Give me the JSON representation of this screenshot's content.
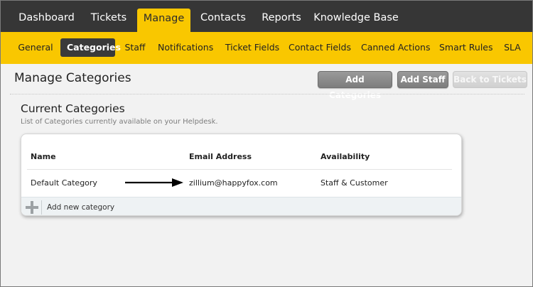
{
  "topnav": {
    "tabs": [
      {
        "label": "Dashboard"
      },
      {
        "label": "Tickets"
      },
      {
        "label": "Manage"
      },
      {
        "label": "Contacts"
      },
      {
        "label": "Reports"
      },
      {
        "label": "Knowledge Base"
      }
    ],
    "active": "Manage"
  },
  "subnav": {
    "items": [
      {
        "label": "General"
      },
      {
        "label": "Categories"
      },
      {
        "label": "Staff"
      },
      {
        "label": "Notifications"
      },
      {
        "label": "Ticket Fields"
      },
      {
        "label": "Contact Fields"
      },
      {
        "label": "Canned Actions"
      },
      {
        "label": "Smart Rules"
      },
      {
        "label": "SLA"
      }
    ],
    "active": "Categories"
  },
  "page": {
    "title": "Manage Categories",
    "buttons": {
      "add_categories": "Add Categories",
      "add_staff": "Add Staff",
      "back_to_tickets": "Back to Tickets"
    }
  },
  "section": {
    "title": "Current Categories",
    "subtitle": "List of Categories currently available on your Helpdesk."
  },
  "table": {
    "columns": [
      "Name",
      "Email Address",
      "Availability"
    ],
    "rows": [
      {
        "name": "Default Category",
        "email": "zillium@happyfox.com",
        "availability": "Staff & Customer"
      }
    ],
    "add_label": "Add new category"
  },
  "colors": {
    "topnav_bg": "#363636",
    "accent": "#f9c700",
    "active_sub_bg": "#3a3a3a"
  }
}
